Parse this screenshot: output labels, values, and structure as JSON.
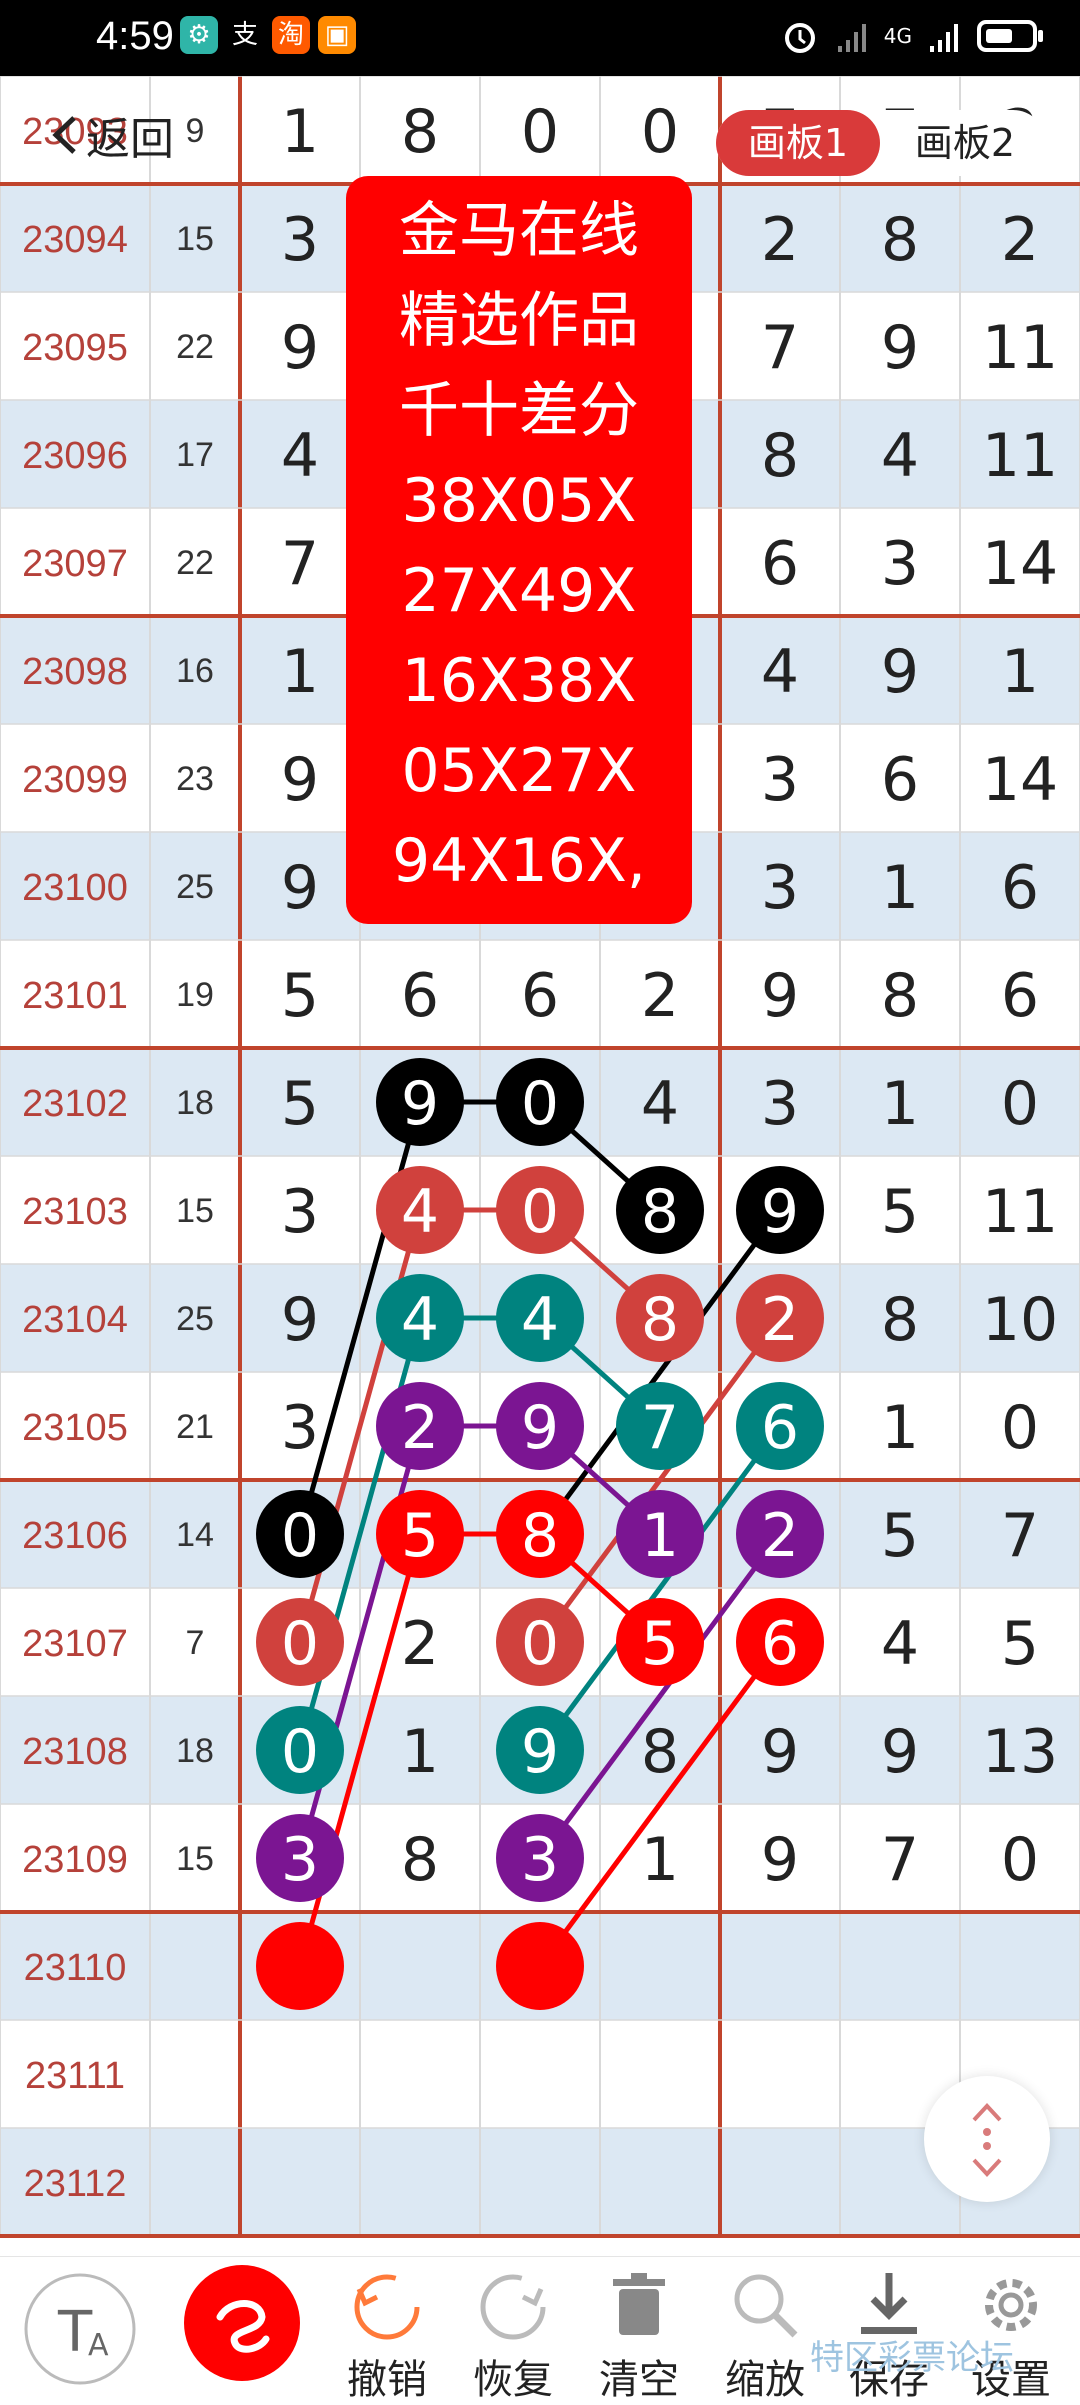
{
  "status_bar": {
    "time": "4:59",
    "app_icons": [
      "支",
      "淘"
    ],
    "network": "4G"
  },
  "header": {
    "back_label": "返回",
    "tabs": [
      "画板1",
      "画板2"
    ],
    "active_tab": 0
  },
  "note": {
    "lines": [
      "金马在线",
      "精选作品",
      "千十差分",
      "38X05X",
      "27X49X",
      "16X38X",
      "05X27X",
      "94X16X,"
    ]
  },
  "table": {
    "rows": [
      {
        "id": "23093",
        "sum": "9",
        "cells": [
          "1",
          "8",
          "0",
          "0",
          "7",
          "7",
          "2"
        ]
      },
      {
        "id": "23094",
        "sum": "15",
        "cells": [
          "3",
          "",
          "",
          "",
          "2",
          "8",
          "2"
        ]
      },
      {
        "id": "23095",
        "sum": "22",
        "cells": [
          "9",
          "",
          "",
          "",
          "7",
          "9",
          "11"
        ]
      },
      {
        "id": "23096",
        "sum": "17",
        "cells": [
          "4",
          "",
          "",
          "",
          "8",
          "4",
          "11"
        ]
      },
      {
        "id": "23097",
        "sum": "22",
        "cells": [
          "7",
          "",
          "",
          "",
          "6",
          "3",
          "14"
        ]
      },
      {
        "id": "23098",
        "sum": "16",
        "cells": [
          "1",
          "",
          "",
          "",
          "4",
          "9",
          "1"
        ]
      },
      {
        "id": "23099",
        "sum": "23",
        "cells": [
          "9",
          "",
          "",
          "",
          "3",
          "6",
          "14"
        ]
      },
      {
        "id": "23100",
        "sum": "25",
        "cells": [
          "9",
          "",
          "",
          "",
          "3",
          "1",
          "6"
        ]
      },
      {
        "id": "23101",
        "sum": "19",
        "cells": [
          "5",
          "6",
          "6",
          "2",
          "9",
          "8",
          "6"
        ]
      },
      {
        "id": "23102",
        "sum": "18",
        "cells": [
          "5",
          "9",
          "0",
          "4",
          "3",
          "1",
          "0"
        ]
      },
      {
        "id": "23103",
        "sum": "15",
        "cells": [
          "3",
          "4",
          "0",
          "8",
          "9",
          "5",
          "11"
        ]
      },
      {
        "id": "23104",
        "sum": "25",
        "cells": [
          "9",
          "4",
          "4",
          "8",
          "2",
          "8",
          "10"
        ]
      },
      {
        "id": "23105",
        "sum": "21",
        "cells": [
          "3",
          "2",
          "9",
          "7",
          "6",
          "1",
          "0"
        ]
      },
      {
        "id": "23106",
        "sum": "14",
        "cells": [
          "0",
          "5",
          "8",
          "1",
          "2",
          "5",
          "7"
        ]
      },
      {
        "id": "23107",
        "sum": "7",
        "cells": [
          "0",
          "2",
          "0",
          "5",
          "6",
          "4",
          "5"
        ]
      },
      {
        "id": "23108",
        "sum": "18",
        "cells": [
          "0",
          "1",
          "9",
          "8",
          "9",
          "9",
          "13"
        ]
      },
      {
        "id": "23109",
        "sum": "15",
        "cells": [
          "3",
          "8",
          "3",
          "1",
          "9",
          "7",
          "0"
        ]
      },
      {
        "id": "23110",
        "sum": "",
        "cells": [
          "",
          "",
          "",
          "",
          "",
          "",
          ""
        ]
      },
      {
        "id": "23111",
        "sum": "",
        "cells": [
          "",
          "",
          "",
          "",
          "",
          "",
          ""
        ]
      },
      {
        "id": "23112",
        "sum": "",
        "cells": [
          "",
          "",
          "",
          "",
          "",
          "",
          ""
        ]
      }
    ],
    "circles": [
      {
        "row": 9,
        "col": 1,
        "color": "#000000"
      },
      {
        "row": 9,
        "col": 2,
        "color": "#000000"
      },
      {
        "row": 10,
        "col": 3,
        "color": "#000000"
      },
      {
        "row": 10,
        "col": 4,
        "color": "#000000"
      },
      {
        "row": 13,
        "col": 0,
        "color": "#000000"
      },
      {
        "row": 10,
        "col": 1,
        "color": "#d0413d"
      },
      {
        "row": 10,
        "col": 2,
        "color": "#d0413d"
      },
      {
        "row": 11,
        "col": 3,
        "color": "#d0413d"
      },
      {
        "row": 11,
        "col": 4,
        "color": "#d0413d"
      },
      {
        "row": 14,
        "col": 0,
        "color": "#d0413d"
      },
      {
        "row": 14,
        "col": 2,
        "color": "#d0413d"
      },
      {
        "row": 11,
        "col": 1,
        "color": "#00837f"
      },
      {
        "row": 11,
        "col": 2,
        "color": "#00837f"
      },
      {
        "row": 12,
        "col": 3,
        "color": "#00837f"
      },
      {
        "row": 12,
        "col": 4,
        "color": "#00837f"
      },
      {
        "row": 15,
        "col": 0,
        "color": "#00837f"
      },
      {
        "row": 15,
        "col": 2,
        "color": "#00837f"
      },
      {
        "row": 12,
        "col": 1,
        "color": "#7b1592"
      },
      {
        "row": 12,
        "col": 2,
        "color": "#7b1592"
      },
      {
        "row": 13,
        "col": 3,
        "color": "#7b1592"
      },
      {
        "row": 13,
        "col": 4,
        "color": "#7b1592"
      },
      {
        "row": 16,
        "col": 0,
        "color": "#7b1592"
      },
      {
        "row": 16,
        "col": 2,
        "color": "#7b1592"
      },
      {
        "row": 13,
        "col": 1,
        "color": "#ff0000"
      },
      {
        "row": 13,
        "col": 2,
        "color": "#ff0000"
      },
      {
        "row": 14,
        "col": 3,
        "color": "#ff0000"
      },
      {
        "row": 14,
        "col": 4,
        "color": "#ff0000"
      },
      {
        "row": 17,
        "col": 0,
        "color": "#ff0000"
      },
      {
        "row": 17,
        "col": 2,
        "color": "#ff0000"
      }
    ],
    "lines": [
      {
        "color": "#000000",
        "path": [
          [
            13,
            0
          ],
          [
            9,
            1
          ],
          [
            9,
            2
          ],
          [
            10,
            3
          ]
        ]
      },
      {
        "color": "#000000",
        "path": [
          [
            13,
            2
          ],
          [
            10,
            4
          ]
        ]
      },
      {
        "color": "#d0413d",
        "path": [
          [
            14,
            0
          ],
          [
            10,
            1
          ],
          [
            10,
            2
          ],
          [
            11,
            3
          ]
        ]
      },
      {
        "color": "#d0413d",
        "path": [
          [
            14,
            2
          ],
          [
            11,
            4
          ]
        ]
      },
      {
        "color": "#00837f",
        "path": [
          [
            15,
            0
          ],
          [
            11,
            1
          ],
          [
            11,
            2
          ],
          [
            12,
            3
          ]
        ]
      },
      {
        "color": "#00837f",
        "path": [
          [
            15,
            2
          ],
          [
            12,
            4
          ]
        ]
      },
      {
        "color": "#7b1592",
        "path": [
          [
            16,
            0
          ],
          [
            12,
            1
          ],
          [
            12,
            2
          ],
          [
            13,
            3
          ]
        ]
      },
      {
        "color": "#7b1592",
        "path": [
          [
            16,
            2
          ],
          [
            13,
            4
          ]
        ]
      },
      {
        "color": "#ff0000",
        "path": [
          [
            17,
            0
          ],
          [
            13,
            1
          ],
          [
            13,
            2
          ],
          [
            14,
            3
          ]
        ]
      },
      {
        "color": "#ff0000",
        "path": [
          [
            17,
            2
          ],
          [
            14,
            4
          ]
        ]
      }
    ]
  },
  "toolbar": {
    "undo_label": "撤销",
    "redo_label": "恢复",
    "clear_label": "清空",
    "zoom_label": "缩放",
    "save_label": "保存",
    "settings_label": "设置"
  },
  "watermark": "特区彩票论坛",
  "colors": {
    "grid_red": "#c0442c",
    "row_alt": "#dce8f3",
    "id_text": "#b5413a",
    "accent": "#d93a3a"
  }
}
